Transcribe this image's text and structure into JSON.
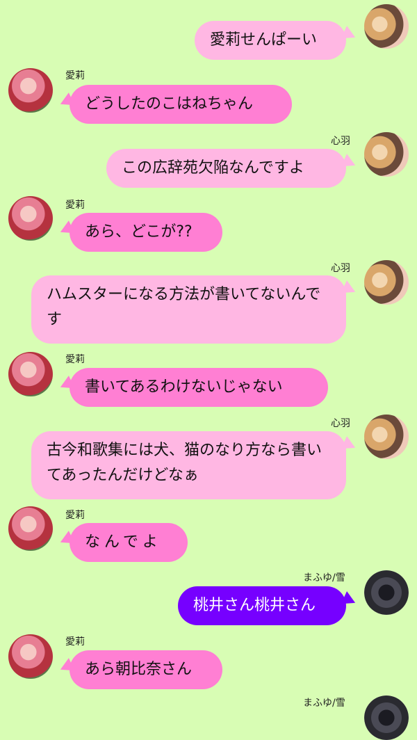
{
  "colors": {
    "background": "#d8fdb4",
    "bubble_airi": "#ff7fd3",
    "bubble_kohane": "#ffb7e3",
    "bubble_mafuyu": "#7600ff"
  },
  "messages": [
    {
      "sender": "",
      "avatar_icon": "kohane-avatar-icon",
      "text": "愛莉せんぱーい"
    },
    {
      "sender": "愛莉",
      "avatar_icon": "airi-avatar-icon",
      "text": "どうしたのこはねちゃん"
    },
    {
      "sender": "心羽",
      "avatar_icon": "kohane-avatar-icon",
      "text": "この広辞苑欠陥なんですよ"
    },
    {
      "sender": "愛莉",
      "avatar_icon": "airi-avatar-icon",
      "text": "あら、どこが??"
    },
    {
      "sender": "心羽",
      "avatar_icon": "kohane-avatar-icon",
      "text": "ハムスターになる方法が書いてないんです"
    },
    {
      "sender": "愛莉",
      "avatar_icon": "airi-avatar-icon",
      "text": "書いてあるわけないじゃない"
    },
    {
      "sender": "心羽",
      "avatar_icon": "kohane-avatar-icon",
      "text": "古今和歌集には犬、猫のなり方なら書いてあったんだけどなぁ"
    },
    {
      "sender": "愛莉",
      "avatar_icon": "airi-avatar-icon",
      "text": "なんでよ"
    },
    {
      "sender": "まふゆ/雪",
      "avatar_icon": "mafuyu-avatar-icon",
      "text": "桃井さん桃井さん"
    },
    {
      "sender": "愛莉",
      "avatar_icon": "airi-avatar-icon",
      "text": "あら朝比奈さん"
    },
    {
      "sender": "まふゆ/雪",
      "avatar_icon": "mafuyu-avatar-icon",
      "text": ""
    }
  ]
}
